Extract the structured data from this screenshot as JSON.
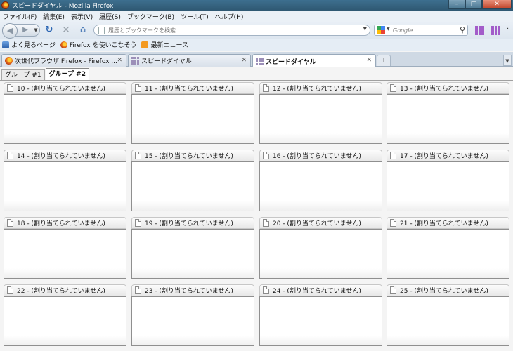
{
  "window": {
    "title": "スピードダイヤル - Mozilla Firefox",
    "controls": {
      "minimize": "–",
      "maximize": "□",
      "close": "✕"
    }
  },
  "menu": [
    "ファイル(F)",
    "編集(E)",
    "表示(V)",
    "履歴(S)",
    "ブックマーク(B)",
    "ツール(T)",
    "ヘルプ(H)"
  ],
  "navbar": {
    "url_placeholder": "履歴とブックマークを検索",
    "search_placeholder": "Google"
  },
  "bookmarks": [
    {
      "label": "よく見るページ",
      "icon": "bookmark-star-icon"
    },
    {
      "label": "Firefox を使いこなそう",
      "icon": "firefox-icon"
    },
    {
      "label": "最新ニュース",
      "icon": "rss-icon"
    }
  ],
  "tabs": [
    {
      "label": "次世代ブラウザ Firefox - Firefox ...",
      "icon": "firefox-icon",
      "active": false
    },
    {
      "label": "スピードダイヤル",
      "icon": "speed-dial-icon",
      "active": false
    },
    {
      "label": "スピードダイヤル",
      "icon": "speed-dial-icon",
      "active": true
    }
  ],
  "groups": [
    "グループ #1",
    "グループ #2"
  ],
  "dials": [
    "10 - (割り当てられていません)",
    "11 - (割り当てられていません)",
    "12 - (割り当てられていません)",
    "13 - (割り当てられていません)",
    "14 - (割り当てられていません)",
    "15 - (割り当てられていません)",
    "16 - (割り当てられていません)",
    "17 - (割り当てられていません)",
    "18 - (割り当てられていません)",
    "19 - (割り当てられていません)",
    "20 - (割り当てられていません)",
    "21 - (割り当てられていません)",
    "22 - (割り当てられていません)",
    "23 - (割り当てられていません)",
    "24 - (割り当てられていません)",
    "25 - (割り当てられていません)"
  ]
}
